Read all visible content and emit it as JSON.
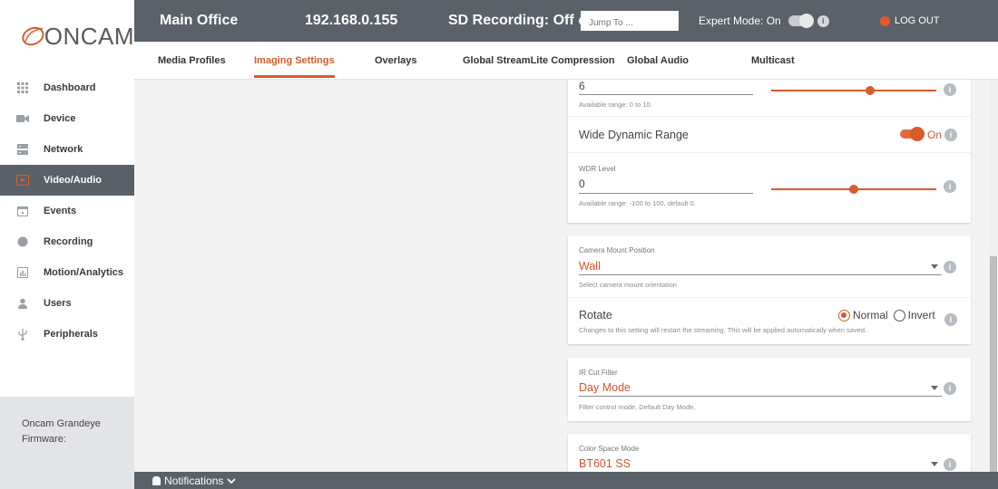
{
  "brand": {
    "name": "ONCAM",
    "logo_color": "#d95a2b"
  },
  "sidebar": {
    "items": [
      {
        "label": "Dashboard",
        "icon": "grid-icon"
      },
      {
        "label": "Device",
        "icon": "camera-icon"
      },
      {
        "label": "Network",
        "icon": "server-icon"
      },
      {
        "label": "Video/Audio",
        "icon": "play-icon",
        "active": true
      },
      {
        "label": "Events",
        "icon": "calendar-icon"
      },
      {
        "label": "Recording",
        "icon": "record-icon"
      },
      {
        "label": "Motion/Analytics",
        "icon": "chart-icon"
      },
      {
        "label": "Users",
        "icon": "user-icon"
      },
      {
        "label": "Peripherals",
        "icon": "usb-icon"
      }
    ],
    "footer": {
      "line1": "Oncam Grandeye",
      "line2": "Firmware:"
    }
  },
  "header": {
    "location": "Main Office",
    "ip": "192.168.0.155",
    "sd_recording": "SD Recording: Off",
    "jump_placeholder": "Jump To ...",
    "expert_mode": "Expert Mode: On",
    "logout": "LOG OUT"
  },
  "tabs": [
    {
      "label": "Media Profiles"
    },
    {
      "label": "Imaging Settings",
      "active": true
    },
    {
      "label": "Overlays"
    },
    {
      "label": "Global StreamLite Compression"
    },
    {
      "label": "Global Audio"
    },
    {
      "label": "Multicast"
    }
  ],
  "settings": {
    "top_slider": {
      "value": "6",
      "range": "Available range: 0 to 10.",
      "fraction": 0.6
    },
    "wdr": {
      "label": "Wide Dynamic Range",
      "state": "On"
    },
    "wdr_level": {
      "label": "WDR Level",
      "value": "0",
      "range": "Available range: -100 to 100, default 0.",
      "fraction": 0.5
    },
    "mount": {
      "label": "Camera Mount Position",
      "value": "Wall",
      "hint": "Select camera mount orientation"
    },
    "rotate": {
      "label": "Rotate",
      "opt_normal": "Normal",
      "opt_invert": "Invert",
      "hint": "Changes to this setting will restart the streaming. This will be applied automatically when saved."
    },
    "ir_cut": {
      "label": "IR Cut Filter",
      "value": "Day Mode",
      "hint": "Filter control mode. Default Day Mode."
    },
    "color_space": {
      "label": "Color Space Mode",
      "value": "BT601 SS"
    }
  },
  "notifications": {
    "label": "Notifications"
  },
  "colors": {
    "accent": "#d95a2b",
    "header": "#5b6168"
  }
}
